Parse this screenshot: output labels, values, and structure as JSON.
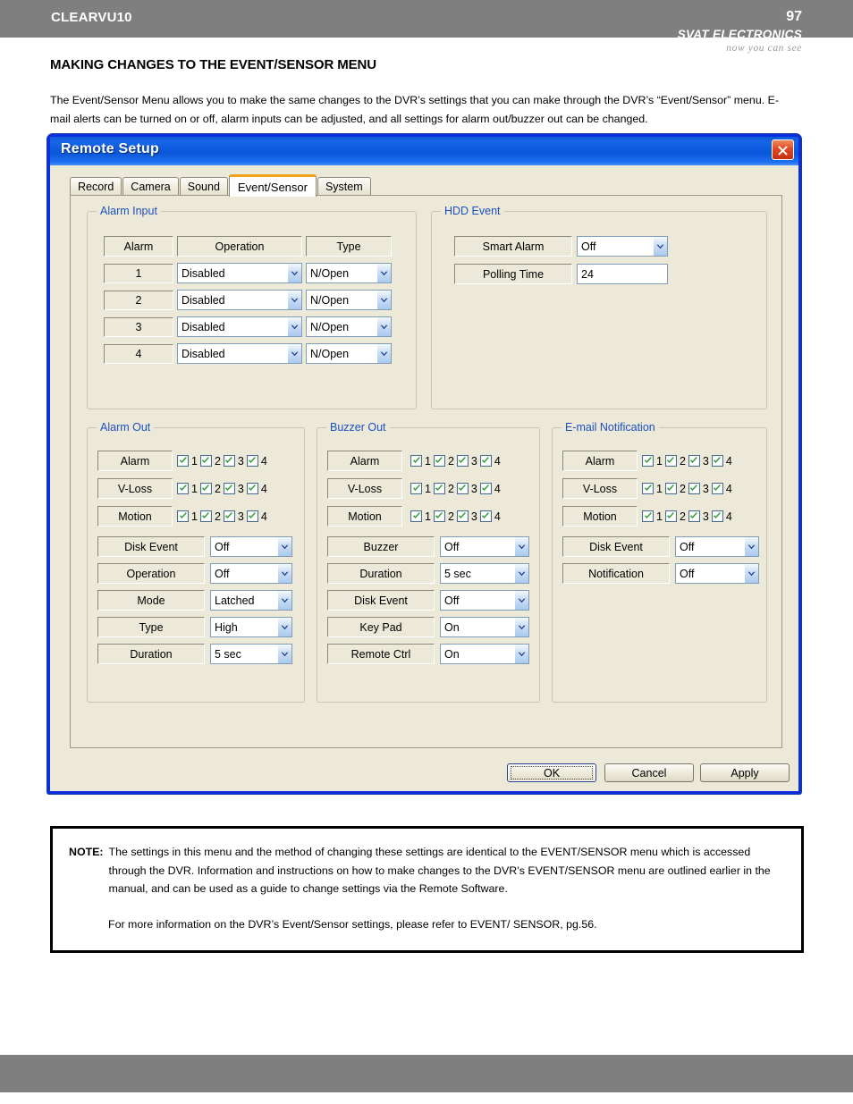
{
  "header": {
    "brand_name": "SVAT ELECTRONICS",
    "brand_tagline": "now you can see"
  },
  "footer": {
    "model": "CLEARVU10",
    "page_number": "97"
  },
  "page": {
    "title": "MAKING CHANGES TO THE EVENT/SENSOR MENU",
    "intro": "The Event/Sensor Menu allows you to make the same changes to the DVR’s settings that you can make through the DVR’s “Event/Sensor” menu. E-mail alerts can be turned on or off, alarm inputs can be adjusted, and all settings for alarm out/buzzer out can be changed."
  },
  "dialog": {
    "title": "Remote Setup",
    "close_label": "✕",
    "tabs": [
      {
        "label": "Record",
        "active": false
      },
      {
        "label": "Camera",
        "active": false
      },
      {
        "label": "Sound",
        "active": false
      },
      {
        "label": "Event/Sensor",
        "active": true
      },
      {
        "label": "System",
        "active": false
      }
    ],
    "alarm_input": {
      "title": "Alarm Input",
      "columns": [
        "Alarm",
        "Operation",
        "Type"
      ],
      "rows": [
        {
          "alarm": "1",
          "operation": "Disabled",
          "type": "N/Open"
        },
        {
          "alarm": "2",
          "operation": "Disabled",
          "type": "N/Open"
        },
        {
          "alarm": "3",
          "operation": "Disabled",
          "type": "N/Open"
        },
        {
          "alarm": "4",
          "operation": "Disabled",
          "type": "N/Open"
        }
      ]
    },
    "hdd_event": {
      "title": "HDD Event",
      "smart_alarm_label": "Smart Alarm",
      "smart_alarm_value": "Off",
      "polling_time_label": "Polling Time",
      "polling_time_value": "24"
    },
    "alarm_out": {
      "title": "Alarm Out",
      "check_rows": [
        {
          "label": "Alarm",
          "channels": [
            "1",
            "2",
            "3",
            "4"
          ],
          "checked": [
            true,
            true,
            true,
            true
          ]
        },
        {
          "label": "V-Loss",
          "channels": [
            "1",
            "2",
            "3",
            "4"
          ],
          "checked": [
            true,
            true,
            true,
            true
          ]
        },
        {
          "label": "Motion",
          "channels": [
            "1",
            "2",
            "3",
            "4"
          ],
          "checked": [
            true,
            true,
            true,
            true
          ]
        }
      ],
      "selects": [
        {
          "label": "Disk Event",
          "value": "Off"
        },
        {
          "label": "Operation",
          "value": "Off"
        },
        {
          "label": "Mode",
          "value": "Latched"
        },
        {
          "label": "Type",
          "value": "High"
        },
        {
          "label": "Duration",
          "value": "5 sec"
        }
      ]
    },
    "buzzer_out": {
      "title": "Buzzer Out",
      "check_rows": [
        {
          "label": "Alarm",
          "channels": [
            "1",
            "2",
            "3",
            "4"
          ],
          "checked": [
            true,
            true,
            true,
            true
          ]
        },
        {
          "label": "V-Loss",
          "channels": [
            "1",
            "2",
            "3",
            "4"
          ],
          "checked": [
            true,
            true,
            true,
            true
          ]
        },
        {
          "label": "Motion",
          "channels": [
            "1",
            "2",
            "3",
            "4"
          ],
          "checked": [
            true,
            true,
            true,
            true
          ]
        }
      ],
      "selects": [
        {
          "label": "Buzzer",
          "value": "Off"
        },
        {
          "label": "Duration",
          "value": "5 sec"
        },
        {
          "label": "Disk Event",
          "value": "Off"
        },
        {
          "label": "Key Pad",
          "value": "On"
        },
        {
          "label": "Remote Ctrl",
          "value": "On"
        }
      ]
    },
    "email_notification": {
      "title": "E-mail Notification",
      "check_rows": [
        {
          "label": "Alarm",
          "channels": [
            "1",
            "2",
            "3",
            "4"
          ],
          "checked": [
            true,
            true,
            true,
            true
          ]
        },
        {
          "label": "V-Loss",
          "channels": [
            "1",
            "2",
            "3",
            "4"
          ],
          "checked": [
            true,
            true,
            true,
            true
          ]
        },
        {
          "label": "Motion",
          "channels": [
            "1",
            "2",
            "3",
            "4"
          ],
          "checked": [
            true,
            true,
            true,
            true
          ]
        }
      ],
      "selects": [
        {
          "label": "Disk Event",
          "value": "Off"
        },
        {
          "label": "Notification",
          "value": "Off"
        }
      ]
    },
    "buttons": {
      "ok": "OK",
      "cancel": "Cancel",
      "apply": "Apply"
    }
  },
  "note": {
    "label": "NOTE:",
    "paragraph1": "The settings in this menu and the method of changing these settings are identical to the EVENT/SENSOR menu which is accessed through the DVR.  Information and instructions on how to make changes to the DVR’s EVENT/SENSOR menu are outlined earlier in the manual, and can be used as a guide to change settings via the Remote Software.",
    "paragraph2": "For more information on the DVR’s Event/Sensor settings, please refer to EVENT/ SENSOR, pg.56."
  },
  "colors": {
    "header_gray": "#7f7f7f",
    "dialog_border_blue": "#0a2ee0",
    "titlebar_blue": "#0b5ad6",
    "group_label_blue": "#1b4fc4",
    "dialog_face": "#ece9d8",
    "active_tab_accent": "#f0a21a",
    "check_green": "#2e9b34",
    "close_red": "#d63b14"
  }
}
